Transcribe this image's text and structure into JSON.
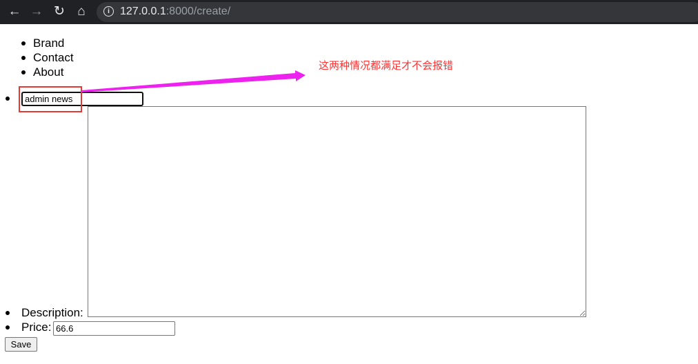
{
  "browser": {
    "url_host": "127.0.0.1",
    "url_rest": ":8000/create/",
    "icons": [
      "back-arrow-icon",
      "forward-arrow-icon",
      "reload-icon",
      "home-icon",
      "info-icon"
    ]
  },
  "nav": {
    "items": [
      {
        "label": "Brand"
      },
      {
        "label": "Contact"
      },
      {
        "label": "About"
      }
    ]
  },
  "form": {
    "title_value": "admin news",
    "description_label": "Description:",
    "description_value": "",
    "price_label": "Price:",
    "price_value": "66.6",
    "save_label": "Save"
  },
  "annotation": {
    "text": "这两种情况都满足才不会报错",
    "box_color": "#e53935",
    "arrow_color": "#ee22ee",
    "text_color": "#ff3333"
  }
}
